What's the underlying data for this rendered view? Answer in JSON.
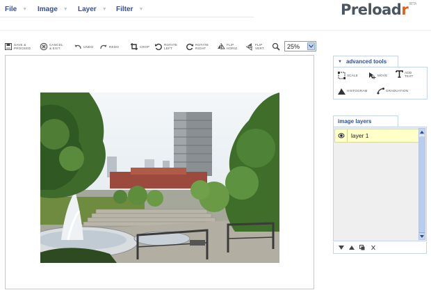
{
  "menu": {
    "items": [
      {
        "label": "File"
      },
      {
        "label": "Image"
      },
      {
        "label": "Layer"
      },
      {
        "label": "Filter"
      }
    ]
  },
  "logo": {
    "text_main": "Preload",
    "text_accent": "r",
    "tag": "BETA"
  },
  "toolbar": {
    "tools": [
      {
        "icon": "save-icon",
        "label": "Save &\nproceed"
      },
      {
        "icon": "cancel-icon",
        "label": "Cancel\n& exit"
      },
      {
        "icon": "undo-icon",
        "label": "Undo"
      },
      {
        "icon": "redo-icon",
        "label": "Redo"
      },
      {
        "icon": "crop-icon",
        "label": "Crop"
      },
      {
        "icon": "rotate-left-icon",
        "label": "Rotate\nleft"
      },
      {
        "icon": "rotate-right-icon",
        "label": "Rotate\nright"
      },
      {
        "icon": "flip-horizontal-icon",
        "label": "Flip\nhoriz."
      },
      {
        "icon": "flip-vertical-icon",
        "label": "Flip\nvert."
      },
      {
        "icon": "zoom-icon",
        "label": ""
      }
    ],
    "zoom_value": "25%"
  },
  "advanced_tools": {
    "title": "advanced tools",
    "tools": [
      {
        "icon": "scale-icon",
        "label": "Scale"
      },
      {
        "icon": "move-icon",
        "label": "Move"
      },
      {
        "icon": "add-text-icon",
        "label": "Add\ntext"
      },
      {
        "icon": "histogram-icon",
        "label": "Histogram"
      },
      {
        "icon": "graduation-icon",
        "label": "Graduation"
      }
    ]
  },
  "image_layers": {
    "title": "image layers",
    "layers": [
      {
        "name": "layer 1",
        "visible": true
      }
    ]
  },
  "colors": {
    "menu_text": "#2f4f9f",
    "accent_orange": "#e0601a",
    "layer_selected": "#ffffc8",
    "panel_border": "#c6d4ea"
  }
}
